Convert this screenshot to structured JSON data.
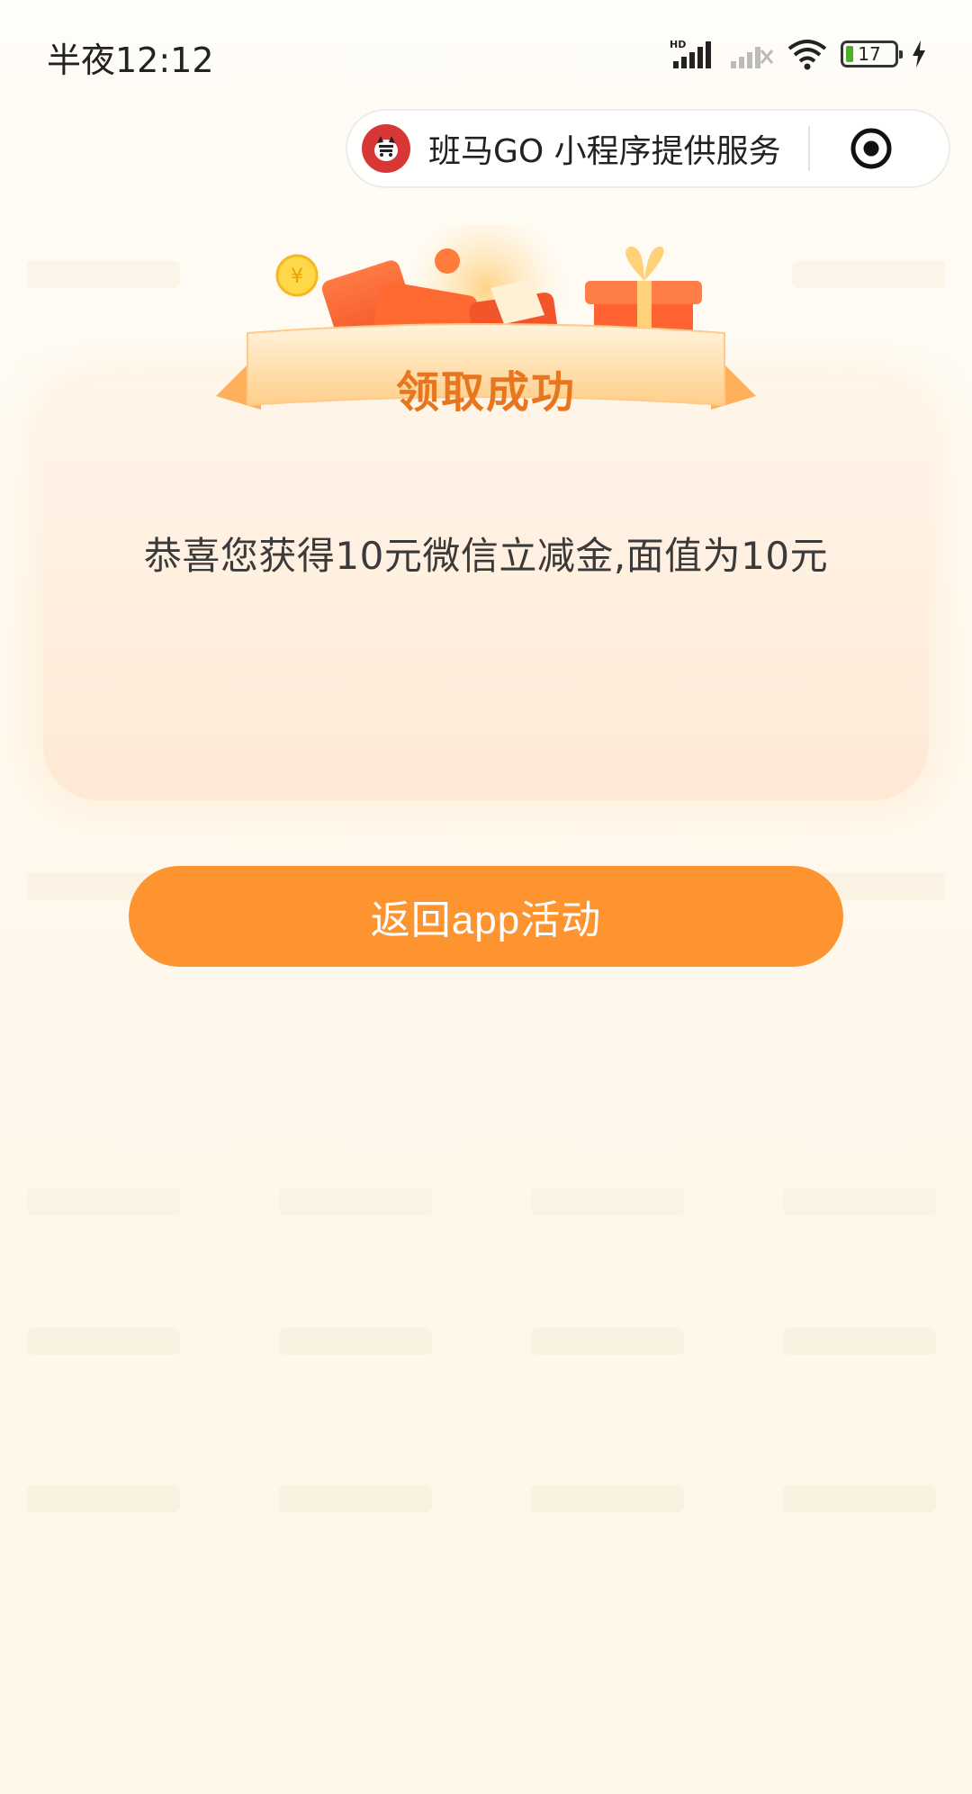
{
  "status_bar": {
    "time": "半夜12:12",
    "signal_label": "HD",
    "battery_level": "17"
  },
  "capsule": {
    "title": "班马GO 小程序提供服务",
    "logo_icon": "zebra-logo-icon",
    "close_icon": "target-close-icon"
  },
  "banner": {
    "title": "领取成功"
  },
  "card": {
    "message": "恭喜您获得10元微信立减金,面值为10元"
  },
  "actions": {
    "return_label": "返回app活动"
  },
  "colors": {
    "accent": "#fe9430",
    "banner_text": "#e8761e",
    "card_top": "#fff5e9",
    "card_bottom": "#ffe9d6",
    "battery_fill": "#4caf2a"
  }
}
